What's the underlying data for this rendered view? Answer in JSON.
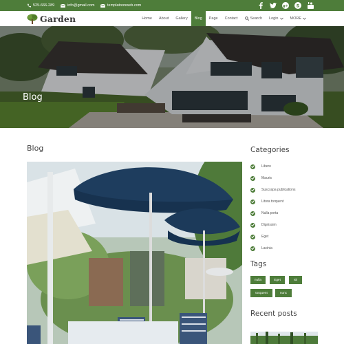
{
  "topbar": {
    "phone": "525-666-289",
    "email": "info@gmail.com",
    "website": "templatoonweb.com",
    "social_icons": [
      "facebook-icon",
      "twitter-icon",
      "google-plus-icon",
      "skype-icon",
      "youtube-icon"
    ]
  },
  "nav": {
    "logo": "Garden",
    "items": [
      "Home",
      "About",
      "Gallery",
      "Blog",
      "Page",
      "Contact",
      "Search",
      "Login",
      "MORE"
    ],
    "active": "Blog"
  },
  "hero": {
    "title": "Blog"
  },
  "main": {
    "title": "Blog"
  },
  "sidebar": {
    "categories_title": "Categories",
    "categories": [
      "Libero",
      "Mauris",
      "Suscsspa publications",
      "Litora torquent",
      "Nulla porta",
      "Dignissim",
      "Eget",
      "Lacinia"
    ],
    "tags_title": "Tags",
    "tags": [
      "nulla",
      "Eget",
      "sit",
      "torquent",
      "nunc"
    ],
    "recent_title": "Recent posts"
  },
  "colors": {
    "brand_green": "#4e7d3a",
    "text": "#333333"
  }
}
